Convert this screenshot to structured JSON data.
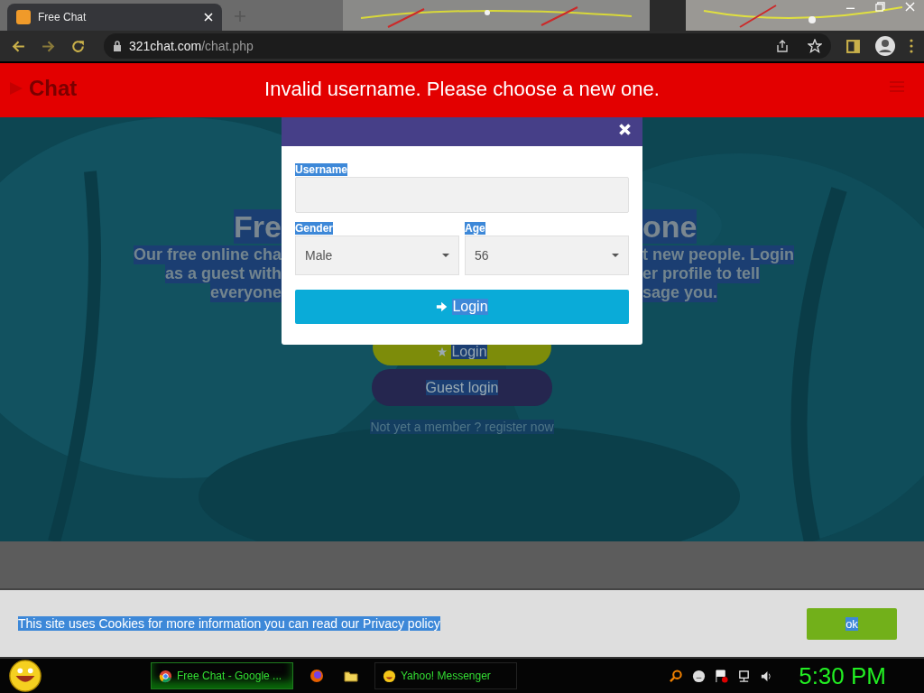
{
  "browser": {
    "tabs": [
      {
        "title": "Free Chat",
        "selected": true
      }
    ],
    "url_host": "321chat.com",
    "url_path": "/chat.php"
  },
  "banner": {
    "logo": "Chat",
    "message": "Invalid username. Please choose a new one."
  },
  "hero": {
    "heading_left": "Fre",
    "heading_right": "one",
    "lines": [
      {
        "left": "Our free online cha",
        "right": "t new people. Login"
      },
      {
        "left": "as a guest with",
        "right": "er profile to tell"
      },
      {
        "left": "everyone",
        "right": "sage you."
      }
    ],
    "login_button": "Login",
    "guest_button": "Guest login",
    "register_link": "Not yet a member ? register now"
  },
  "modal": {
    "username_label": "Username",
    "gender_label": "Gender",
    "gender_value": "Male",
    "age_label": "Age",
    "age_value": "56",
    "submit": "Login"
  },
  "cookie": {
    "text": "This site uses Cookies for more information you can read our Privacy policy",
    "button": "ok"
  },
  "taskbar": {
    "tasks": [
      {
        "kind": "chrome",
        "label": "Free Chat - Google ...",
        "selected": true
      },
      {
        "kind": "firefox",
        "selected": false
      },
      {
        "kind": "folder",
        "selected": false
      },
      {
        "kind": "yahoo",
        "label": "Yahoo! Messenger",
        "selected": false
      }
    ],
    "clock": "5:30 PM"
  }
}
